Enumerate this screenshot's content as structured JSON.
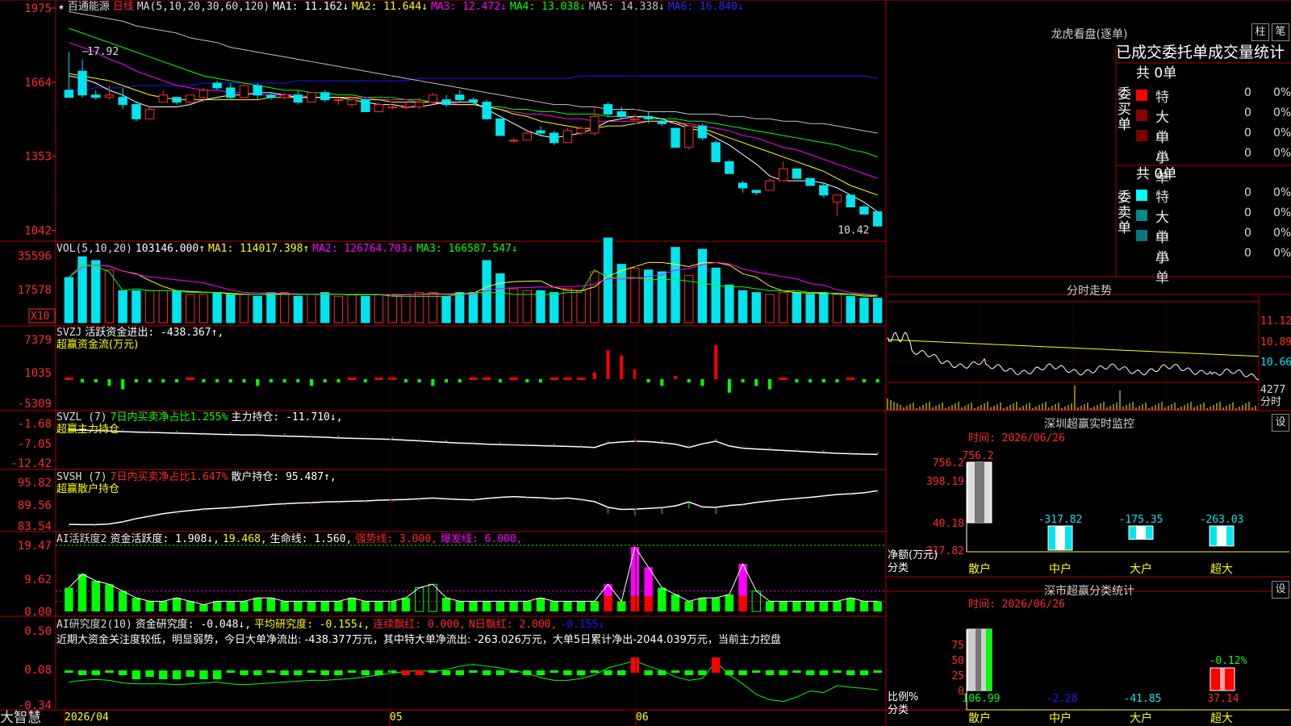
{
  "stock": {
    "name": "百通能源",
    "period": "日线",
    "star": "★"
  },
  "colors": {
    "up": "#ff2a2a",
    "down": "#00e5ee",
    "ma1": "#ffffff",
    "ma2": "#ffff00",
    "ma3": "#ff00ff",
    "ma4": "#00ff00",
    "ma5": "#c0c0c0",
    "ma6": "#1a1aff",
    "green": "#00ff00",
    "red": "#ff0000",
    "yellow": "#ffff00",
    "magenta": "#ff00ff"
  },
  "main": {
    "ma_label": "MA(5,10,20,30,60,120)",
    "ma1": "MA1: 11.162↓",
    "ma2": "MA2: 11.644↓",
    "ma3": "MA3: 12.472↓",
    "ma4": "MA4: 13.038↓",
    "ma5": "MA5: 14.338↓",
    "ma6": "MA6: 16.840↓",
    "y_ticks": [
      "1975",
      "1664",
      "1353",
      "1042"
    ],
    "high_label": "17.92",
    "low_label": "10.42",
    "ohlc": [
      [
        16.3,
        17.9,
        16.0,
        16.0
      ],
      [
        17.1,
        17.6,
        16.0,
        16.1
      ],
      [
        16.1,
        16.3,
        15.9,
        16.0
      ],
      [
        16.0,
        16.5,
        15.9,
        16.1
      ],
      [
        16.0,
        16.4,
        15.5,
        15.7
      ],
      [
        15.7,
        15.8,
        15.0,
        15.1
      ],
      [
        15.1,
        15.6,
        15.1,
        15.5
      ],
      [
        15.8,
        16.3,
        15.8,
        16.1
      ],
      [
        16.0,
        16.0,
        15.7,
        15.8
      ],
      [
        15.8,
        16.1,
        15.7,
        16.1
      ],
      [
        16.0,
        16.4,
        15.8,
        16.3
      ],
      [
        16.6,
        16.7,
        16.3,
        16.4
      ],
      [
        16.4,
        16.6,
        15.9,
        16.0
      ],
      [
        16.0,
        16.6,
        16.0,
        16.5
      ],
      [
        16.5,
        16.6,
        15.9,
        16.1
      ],
      [
        16.1,
        16.2,
        15.9,
        16.0
      ],
      [
        16.0,
        16.2,
        15.9,
        16.1
      ],
      [
        16.1,
        16.3,
        15.7,
        15.8
      ],
      [
        15.8,
        16.2,
        15.8,
        16.2
      ],
      [
        16.2,
        16.3,
        15.8,
        15.9
      ],
      [
        15.9,
        16.0,
        15.7,
        15.9
      ],
      [
        15.7,
        16.0,
        15.6,
        15.9
      ],
      [
        15.9,
        16.0,
        15.4,
        15.4
      ],
      [
        15.4,
        15.8,
        15.4,
        15.7
      ],
      [
        15.6,
        15.7,
        15.5,
        15.6
      ],
      [
        15.6,
        15.8,
        15.5,
        15.6
      ],
      [
        15.6,
        16.0,
        15.5,
        15.8
      ],
      [
        15.8,
        16.2,
        15.7,
        16.1
      ],
      [
        15.9,
        16.1,
        15.6,
        15.7
      ],
      [
        16.1,
        16.3,
        15.8,
        15.9
      ],
      [
        15.9,
        16.0,
        15.7,
        15.8
      ],
      [
        15.8,
        15.9,
        15.1,
        15.1
      ],
      [
        15.1,
        15.1,
        14.4,
        14.4
      ],
      [
        14.2,
        14.3,
        14.1,
        14.2
      ],
      [
        14.2,
        14.6,
        14.2,
        14.5
      ],
      [
        14.6,
        14.8,
        14.4,
        14.5
      ],
      [
        14.5,
        14.6,
        14.0,
        14.1
      ],
      [
        14.1,
        14.7,
        14.1,
        14.6
      ],
      [
        14.5,
        14.8,
        14.4,
        14.7
      ],
      [
        14.5,
        15.6,
        14.4,
        15.2
      ],
      [
        15.7,
        15.8,
        15.2,
        15.3
      ],
      [
        15.4,
        15.6,
        15.1,
        15.2
      ],
      [
        15.1,
        15.3,
        15.0,
        15.1
      ],
      [
        15.2,
        15.4,
        14.9,
        15.1
      ],
      [
        15.0,
        15.1,
        14.8,
        14.9
      ],
      [
        14.7,
        14.7,
        13.9,
        13.9
      ],
      [
        13.9,
        14.8,
        13.8,
        14.8
      ],
      [
        14.8,
        14.9,
        14.2,
        14.3
      ],
      [
        14.1,
        14.2,
        13.3,
        13.3
      ],
      [
        13.3,
        13.4,
        12.8,
        12.8
      ],
      [
        12.4,
        12.5,
        12.0,
        12.2
      ],
      [
        12.1,
        12.1,
        11.9,
        12.0
      ],
      [
        12.1,
        12.6,
        12.1,
        12.5
      ],
      [
        12.5,
        13.3,
        12.5,
        13.0
      ],
      [
        13.0,
        13.0,
        12.6,
        12.6
      ],
      [
        12.6,
        12.6,
        12.3,
        12.3
      ],
      [
        12.3,
        12.4,
        11.8,
        11.9
      ],
      [
        11.6,
        11.9,
        11.0,
        11.9
      ],
      [
        11.9,
        11.9,
        11.4,
        11.4
      ],
      [
        11.4,
        11.5,
        11.1,
        11.1
      ],
      [
        11.2,
        11.2,
        10.6,
        10.6
      ]
    ],
    "ma5_line": [
      16.9,
      16.8,
      16.6,
      16.3,
      16.1,
      15.8,
      15.6,
      15.6,
      15.6,
      15.7,
      15.9,
      16.0,
      16.1,
      16.1,
      16.2,
      16.2,
      16.1,
      16.0,
      16.0,
      16.0,
      16.0,
      15.9,
      15.8,
      15.7,
      15.7,
      15.6,
      15.6,
      15.7,
      15.8,
      15.8,
      15.8,
      15.5,
      15.2,
      14.9,
      14.6,
      14.4,
      14.3,
      14.4,
      14.5,
      14.7,
      15.0,
      15.1,
      15.2,
      15.2,
      15.1,
      14.9,
      14.7,
      14.6,
      14.3,
      14.0,
      13.6,
      13.2,
      12.7,
      12.5,
      12.5,
      12.5,
      12.4,
      12.2,
      11.9,
      11.6,
      11.2
    ],
    "ma10_line": [
      17.0,
      16.9,
      16.8,
      16.7,
      16.5,
      16.3,
      16.1,
      16.0,
      15.9,
      15.9,
      15.9,
      15.9,
      15.9,
      15.9,
      15.9,
      16.0,
      16.0,
      16.0,
      16.0,
      16.0,
      16.0,
      16.0,
      15.9,
      15.9,
      15.8,
      15.8,
      15.8,
      15.8,
      15.7,
      15.7,
      15.7,
      15.6,
      15.5,
      15.3,
      15.2,
      15.0,
      14.9,
      14.8,
      14.7,
      14.7,
      14.8,
      14.8,
      14.9,
      15.0,
      15.0,
      15.0,
      14.8,
      14.7,
      14.5,
      14.3,
      14.1,
      13.9,
      13.7,
      13.5,
      13.3,
      13.1,
      12.9,
      12.6,
      12.3,
      12.1,
      11.9
    ],
    "ma20_line": [
      18.3,
      18.1,
      17.9,
      17.6,
      17.4,
      17.1,
      16.9,
      16.7,
      16.5,
      16.4,
      16.3,
      16.3,
      16.2,
      16.2,
      16.1,
      16.1,
      16.1,
      16.1,
      16.0,
      16.0,
      16.0,
      16.0,
      16.0,
      15.9,
      15.9,
      15.9,
      15.8,
      15.8,
      15.8,
      15.7,
      15.7,
      15.6,
      15.5,
      15.4,
      15.3,
      15.3,
      15.2,
      15.1,
      15.1,
      15.0,
      15.0,
      15.0,
      15.0,
      15.0,
      15.0,
      14.9,
      14.9,
      14.8,
      14.7,
      14.6,
      14.4,
      14.3,
      14.1,
      13.9,
      13.8,
      13.6,
      13.4,
      13.2,
      13.0,
      12.8,
      12.6
    ],
    "ma30_line": [
      18.9,
      18.7,
      18.5,
      18.3,
      18.1,
      17.9,
      17.7,
      17.5,
      17.3,
      17.1,
      16.9,
      16.8,
      16.7,
      16.6,
      16.5,
      16.4,
      16.3,
      16.3,
      16.2,
      16.2,
      16.1,
      16.1,
      16.0,
      16.0,
      16.0,
      15.9,
      15.9,
      15.8,
      15.8,
      15.7,
      15.7,
      15.6,
      15.6,
      15.5,
      15.5,
      15.4,
      15.4,
      15.3,
      15.3,
      15.3,
      15.2,
      15.2,
      15.2,
      15.1,
      15.1,
      15.1,
      15.0,
      15.0,
      14.9,
      14.8,
      14.7,
      14.6,
      14.5,
      14.4,
      14.3,
      14.2,
      14.1,
      14.0,
      13.8,
      13.7,
      13.5
    ],
    "ma60_line": [
      19.6,
      19.5,
      19.4,
      19.3,
      19.2,
      19.0,
      18.9,
      18.8,
      18.7,
      18.5,
      18.4,
      18.3,
      18.1,
      18.0,
      17.9,
      17.8,
      17.7,
      17.6,
      17.5,
      17.4,
      17.3,
      17.2,
      17.1,
      17.0,
      16.9,
      16.8,
      16.7,
      16.6,
      16.5,
      16.4,
      16.3,
      16.2,
      16.1,
      16.0,
      15.9,
      15.8,
      15.7,
      15.7,
      15.6,
      15.6,
      15.5,
      15.5,
      15.5,
      15.4,
      15.4,
      15.4,
      15.3,
      15.3,
      15.3,
      15.2,
      15.2,
      15.1,
      15.1,
      15.0,
      15.0,
      14.9,
      14.9,
      14.8,
      14.7,
      14.6,
      14.5
    ],
    "ma120_line": [
      16.3,
      16.3,
      16.4,
      16.4,
      16.4,
      16.5,
      16.5,
      16.5,
      16.5,
      16.5,
      16.6,
      16.6,
      16.6,
      16.6,
      16.6,
      16.6,
      16.6,
      16.7,
      16.7,
      16.7,
      16.7,
      16.7,
      16.7,
      16.7,
      16.7,
      16.7,
      16.8,
      16.8,
      16.8,
      16.8,
      16.8,
      16.8,
      16.8,
      16.8,
      16.8,
      16.8,
      16.8,
      16.8,
      16.9,
      16.9,
      16.9,
      16.9,
      16.9,
      16.9,
      16.9,
      16.9,
      16.9,
      16.9,
      16.9,
      16.9,
      16.9,
      16.9,
      16.9,
      16.9,
      16.9,
      16.9,
      16.9,
      16.9,
      16.9,
      16.9,
      16.8
    ]
  },
  "vol": {
    "label": "VOL(5,10,20)",
    "value": "103146.000↑",
    "ma1": "MA1: 114017.398↑",
    "ma2": "MA2: 126764.703↓",
    "ma3": "MA3: 166587.547↓",
    "y_ticks": [
      "35596",
      "17578"
    ],
    "unit": "X10",
    "bars": [
      24,
      31,
      30,
      27,
      17,
      18,
      17,
      17,
      17,
      16,
      16,
      16,
      15,
      15,
      15,
      15,
      15,
      15,
      15,
      15,
      15,
      15,
      15,
      15,
      14,
      14,
      14,
      14,
      14,
      15,
      16,
      16,
      16,
      15,
      15,
      15,
      15,
      16,
      16,
      28,
      24,
      24,
      24,
      23,
      23,
      23,
      22,
      21,
      20,
      19,
      19,
      18,
      17,
      17,
      17,
      16,
      16,
      15,
      15,
      14,
      14
    ],
    "bars_real": [
      24,
      35,
      33,
      28,
      17,
      17,
      17,
      17,
      17,
      15,
      15,
      16,
      15,
      15,
      14,
      16,
      16,
      14,
      15,
      16,
      14,
      15,
      14,
      15,
      15,
      15,
      16,
      16,
      14,
      16,
      16,
      33,
      26,
      18,
      17,
      17,
      16,
      18,
      17,
      27,
      45,
      31,
      29,
      28,
      27,
      40,
      25,
      39,
      29,
      20,
      17,
      16,
      15,
      16,
      16,
      15,
      16,
      15,
      14,
      13,
      13
    ]
  },
  "svzj": {
    "label": "SVZJ",
    "desc": "活跃资金进出: -438.367↑,",
    "sub": "超赢资金流(万元)",
    "y_ticks": [
      "7379",
      "1035",
      "-5309"
    ],
    "vals": [
      0.2,
      -1,
      -1,
      -2,
      -3,
      -1,
      -1,
      -1,
      -1,
      0.1,
      -1,
      -1,
      -1,
      -1,
      -2,
      -1,
      -1,
      -1,
      -2,
      -1,
      -1,
      0.2,
      -1,
      0.3,
      0.2,
      -1,
      -1,
      -2,
      -1,
      -1,
      0.2,
      0.1,
      -1,
      0.4,
      -1,
      -1,
      0.2,
      0.5,
      0.3,
      2,
      8.5,
      7,
      3,
      -1,
      -2,
      1,
      -1,
      -2,
      10,
      -4,
      -1,
      -2,
      -3,
      0.2,
      -1,
      -1,
      -1,
      -1,
      0.2,
      -1,
      -1
    ]
  },
  "svzl": {
    "label": "SVZL (7)",
    "desc": "7日内买卖净占比1.255%",
    "hold": "主力持仓: -11.710↓,",
    "sub": "超赢主力持仓",
    "y_ticks": [
      "-1.68",
      "-7.05",
      "-12.42"
    ],
    "vals": [
      -3.4,
      -3.5,
      -3.6,
      -3.7,
      -3.9,
      -4.0,
      -4.1,
      -4.2,
      -4.3,
      -4.4,
      -4.5,
      -4.6,
      -4.7,
      -4.8,
      -4.8,
      -5.0,
      -5.1,
      -5.2,
      -5.3,
      -5.4,
      -5.6,
      -5.7,
      -5.8,
      -5.9,
      -6.0,
      -6.2,
      -6.4,
      -6.6,
      -6.8,
      -7.0,
      -7.1,
      -7.3,
      -7.4,
      -7.5,
      -7.6,
      -7.7,
      -7.8,
      -7.9,
      -8.0,
      -8.2,
      -7.0,
      -6.7,
      -6.5,
      -6.6,
      -6.9,
      -7.3,
      -8.2,
      -7.2,
      -6.5,
      -7.8,
      -8.4,
      -8.6,
      -8.8,
      -9.0,
      -9.2,
      -9.4,
      -9.6,
      -9.8,
      -9.9,
      -10.0,
      -10.1
    ]
  },
  "svsh": {
    "label": "SVSH (7)",
    "desc": "7日内买卖净占比1.647%",
    "hold": "散户持仓: 95.487↑,",
    "sub": "超赢散户持仓",
    "y_ticks": [
      "95.82",
      "89.56",
      "83.54"
    ],
    "vals": [
      84.0,
      83.9,
      83.9,
      84.1,
      84.7,
      85.6,
      86.3,
      87.0,
      87.5,
      87.9,
      88.3,
      88.5,
      88.7,
      89.0,
      89.3,
      89.6,
      89.8,
      90.0,
      90.1,
      90.3,
      90.4,
      90.5,
      90.6,
      90.8,
      90.9,
      91.0,
      91.2,
      91.4,
      91.2,
      91.0,
      90.9,
      91.3,
      91.6,
      91.8,
      91.6,
      91.5,
      91.2,
      91.4,
      91.0,
      90.4,
      88.8,
      88.2,
      88.3,
      88.5,
      88.7,
      89.2,
      90.3,
      88.9,
      88.8,
      89.3,
      89.6,
      90.2,
      90.6,
      91.0,
      91.3,
      91.6,
      92.0,
      92.4,
      92.6,
      92.9,
      93.5
    ]
  },
  "ai1": {
    "label": "AI活跃度2",
    "zj": "资金活跃度: 1.908↓,",
    "val2": "19.468,",
    "sml": "生命线: 1.560,",
    "qsx": "强势线: 3.000,",
    "bfx": "爆发线: 6.000,",
    "y_ticks": [
      "19.47",
      "9.62",
      "0.00"
    ],
    "vals": [
      7,
      11,
      9,
      8,
      6,
      4,
      3,
      3,
      4,
      3,
      2,
      3,
      3,
      3,
      4,
      4,
      3,
      3,
      3,
      3,
      3,
      4,
      3,
      3,
      3,
      4,
      7,
      8,
      4,
      3,
      3,
      3,
      3,
      3,
      3,
      4,
      3,
      3,
      3,
      3,
      8,
      3,
      19,
      13,
      7,
      5,
      3,
      4,
      4,
      5,
      14,
      6,
      3,
      3,
      3,
      3,
      3,
      3,
      4,
      3,
      3
    ]
  },
  "ai2": {
    "label": "AI研究度2(10)",
    "zj": "资金研究度: -0.048↓,",
    "pj": "平均研究度: -0.155↓,",
    "lx": "连续飘红: 0.000,",
    "nr": "N日飘红: 2.000,",
    "nv": "-0.155↓",
    "text": "近期大资金关注度较低，明显弱势，今日大单净流出: -438.377万元，其中特大单净流出: -263.026万元，大单5日累计净出-2044.039万元，当前主力控盘",
    "y_ticks": [
      "0.50",
      "0.08",
      "-0.34"
    ]
  },
  "xaxis": {
    "labels": [
      "2026/04",
      "05",
      "06"
    ],
    "bottom_left": "大智慧"
  },
  "longhu": {
    "title": "龙虎看盘(逐单)",
    "btn1": "柱",
    "btn2": "笔",
    "head": "已成交委托单成交量统计",
    "buy": {
      "side": "委买单",
      "total": "共 0单",
      "rows": [
        {
          "name": "特大",
          "c": "0",
          "p": "0%",
          "col": "#ff0000"
        },
        {
          "name": "大单",
          "c": "0",
          "p": "0%",
          "col": "#8b0000"
        },
        {
          "name": "中单",
          "c": "0",
          "p": "0%",
          "col": "#7a0000"
        },
        {
          "name": "小单",
          "c": "0",
          "p": "0%",
          "col": "#000"
        }
      ]
    },
    "sell": {
      "side": "委卖单",
      "total": "共 0单",
      "rows": [
        {
          "name": "特大",
          "c": "0",
          "p": "0%",
          "col": "#00ffff"
        },
        {
          "name": "大单",
          "c": "0",
          "p": "0%",
          "col": "#008b8b"
        },
        {
          "name": "中单",
          "c": "0",
          "p": "0%",
          "col": "#007a7a"
        },
        {
          "name": "小单",
          "c": "0",
          "p": "0%",
          "col": "#000"
        }
      ]
    }
  },
  "fenshi": {
    "title": "分时走势",
    "y_ticks": [
      "11.12",
      "10.89",
      "10.66"
    ],
    "vol_tick": "4277",
    "vol_unit": "分时"
  },
  "sz_monitor": {
    "title": "深圳超赢实时监控",
    "btn": "设",
    "time": "时间: 2026/06/26",
    "y_ticks": [
      "756.2",
      "398.19",
      "40.18",
      "-317.82"
    ],
    "ylabel": "净额(万元)",
    "xname": "分类",
    "cats": [
      "散户",
      "中户",
      "大户",
      "超大"
    ],
    "vals": [
      756.2,
      -317.82,
      -175.35,
      -263.03
    ],
    "val_labels": [
      "756.2",
      "-317.82",
      "-175.35",
      "-263.03"
    ]
  },
  "sz_class": {
    "title": "深市超赢分类统计",
    "btn": "设",
    "time": "时间: 2026/06/26",
    "y_ticks": [
      "75",
      "50",
      "25",
      "0"
    ],
    "ylabel": "比例%",
    "xname": "分类",
    "cats": [
      "散户",
      "中户",
      "大户",
      "超大"
    ],
    "vals": [
      106.99,
      -2.28,
      -41.85,
      37.14
    ],
    "top_label": "-0.12%",
    "val_labels": [
      "106.99",
      "-2.28",
      "-41.85",
      "37.14"
    ]
  }
}
